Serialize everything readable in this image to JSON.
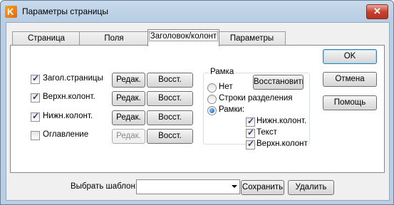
{
  "window": {
    "title": "Параметры страницы",
    "close_label": "✕",
    "app_icon_letter": "K"
  },
  "tabs": [
    {
      "label": "Страница",
      "active": false
    },
    {
      "label": "Поля",
      "active": false
    },
    {
      "label": "Заголовок/колонт",
      "active": true
    },
    {
      "label": "Параметры",
      "active": false
    }
  ],
  "sections": [
    {
      "label": "Загол.страницы",
      "checked": true,
      "edit_label": "Редак.",
      "edit_enabled": true,
      "restore_label": "Восст."
    },
    {
      "label": "Верхн.колонт.",
      "checked": true,
      "edit_label": "Редак.",
      "edit_enabled": true,
      "restore_label": "Восст."
    },
    {
      "label": "Нижн.колонт.",
      "checked": true,
      "edit_label": "Редак.",
      "edit_enabled": true,
      "restore_label": "Восст."
    },
    {
      "label": "Оглавление",
      "checked": false,
      "edit_label": "Редак.",
      "edit_enabled": false,
      "restore_label": "Восст."
    }
  ],
  "frame": {
    "title": "Рамка",
    "restore_label": "Восстановить",
    "options": [
      {
        "label": "Нет",
        "selected": false
      },
      {
        "label": "Строки разделения",
        "selected": false
      },
      {
        "label": "Рамки:",
        "selected": true
      }
    ],
    "frame_items": [
      {
        "label": "Нижн.колонт.",
        "checked": true
      },
      {
        "label": "Текст",
        "checked": true
      },
      {
        "label": "Верхн.колонт",
        "checked": true
      }
    ]
  },
  "side_buttons": {
    "ok": "OK",
    "cancel": "Отмена",
    "help": "Помощь"
  },
  "template": {
    "label": "Выбрать шаблон:",
    "value": "",
    "save_label": "Сохранить",
    "delete_label": "Удалить"
  }
}
